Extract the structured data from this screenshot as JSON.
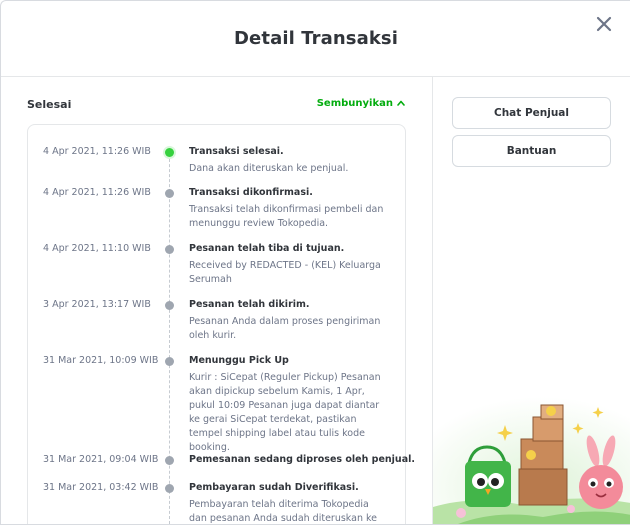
{
  "modal": {
    "title": "Detail Transaksi"
  },
  "status": {
    "label": "Selesai",
    "toggle_label": "Sembunyikan"
  },
  "events": [
    {
      "time": "4 Apr 2021, 11:26 WIB",
      "title": "Transaksi selesai.",
      "desc": "Dana akan diteruskan ke penjual."
    },
    {
      "time": "4 Apr 2021, 11:26 WIB",
      "title": "Transaksi dikonfirmasi.",
      "desc": "Transaksi telah dikonfirmasi pembeli dan menunggu review Tokopedia."
    },
    {
      "time": "4 Apr 2021, 11:10 WIB",
      "title": "Pesanan telah tiba di tujuan.",
      "desc": "Received by REDACTED - (KEL) Keluarga Serumah"
    },
    {
      "time": "3 Apr 2021, 13:17 WIB",
      "title": "Pesanan telah dikirim.",
      "desc": "Pesanan Anda dalam proses pengiriman oleh kurir."
    },
    {
      "time": "31 Mar 2021, 10:09 WIB",
      "title": "Menunggu Pick Up",
      "desc": "Kurir : SiCepat (Reguler Pickup) Pesanan akan dipickup sebelum Kamis, 1 Apr, pukul 10:09 Pesanan juga dapat diantar ke gerai SiCepat terdekat, pastikan tempel shipping label atau tulis kode booking."
    },
    {
      "time": "31 Mar 2021, 09:04 WIB",
      "title": "Pemesanan sedang diproses oleh penjual.",
      "desc": ""
    },
    {
      "time": "31 Mar 2021, 03:42 WIB",
      "title": "Pembayaran sudah Diverifikasi.",
      "desc": "Pembayaran telah diterima Tokopedia dan pesanan Anda sudah diteruskan ke penjual."
    }
  ],
  "actions": {
    "chat_label": "Chat Penjual",
    "help_label": "Bantuan"
  },
  "colors": {
    "accent_green": "#03ac0e",
    "active_dot": "#36d13e",
    "inactive_dot": "#9fa6b0"
  },
  "icons": {
    "close": "close-icon",
    "toggle": "chevron-up-icon"
  }
}
